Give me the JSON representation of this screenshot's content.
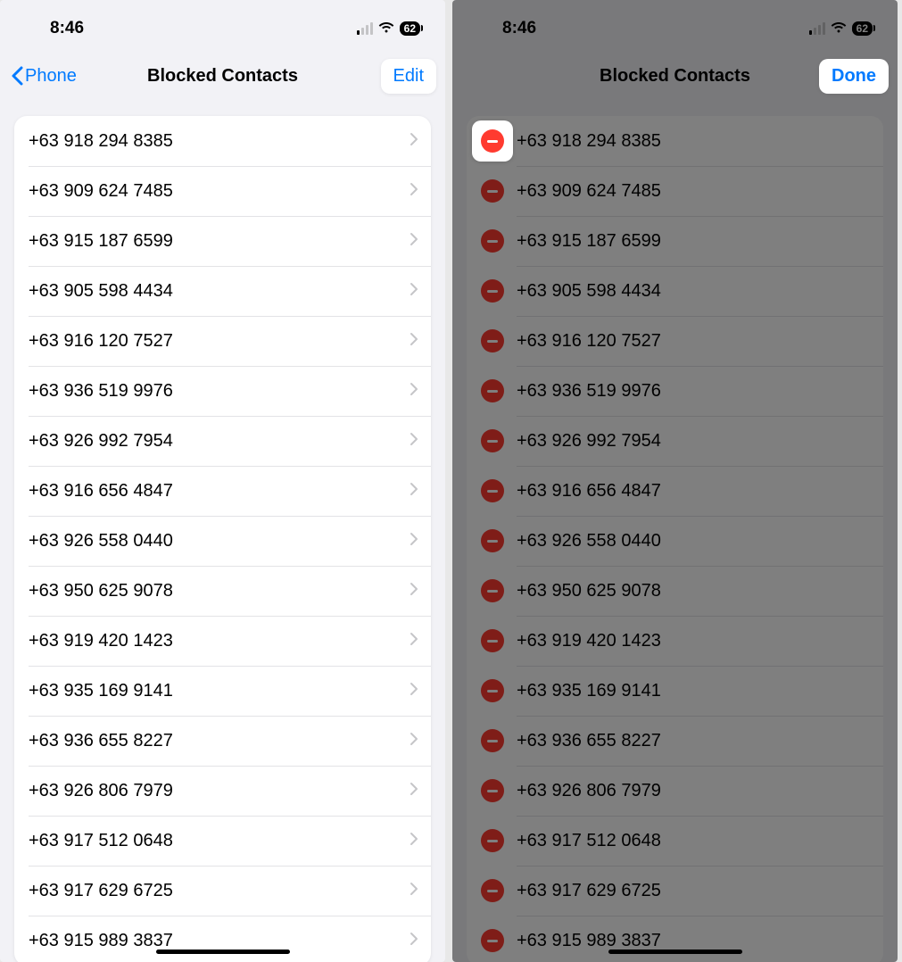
{
  "status": {
    "time": "8:46",
    "battery": "62"
  },
  "screen_left": {
    "back_label": "Phone",
    "title": "Blocked Contacts",
    "action": "Edit"
  },
  "screen_right": {
    "title": "Blocked Contacts",
    "action": "Done"
  },
  "contacts": [
    "+63 918 294 8385",
    "+63 909 624 7485",
    "+63 915 187 6599",
    "+63 905 598 4434",
    "+63 916 120 7527",
    "+63 936 519 9976",
    "+63 926 992 7954",
    "+63 916 656 4847",
    "+63 926 558 0440",
    "+63 950 625 9078",
    "+63 919 420 1423",
    "+63 935 169 9141",
    "+63 936 655 8227",
    "+63 926 806 7979",
    "+63 917 512 0648",
    "+63 917 629 6725",
    "+63 915 989 3837"
  ]
}
